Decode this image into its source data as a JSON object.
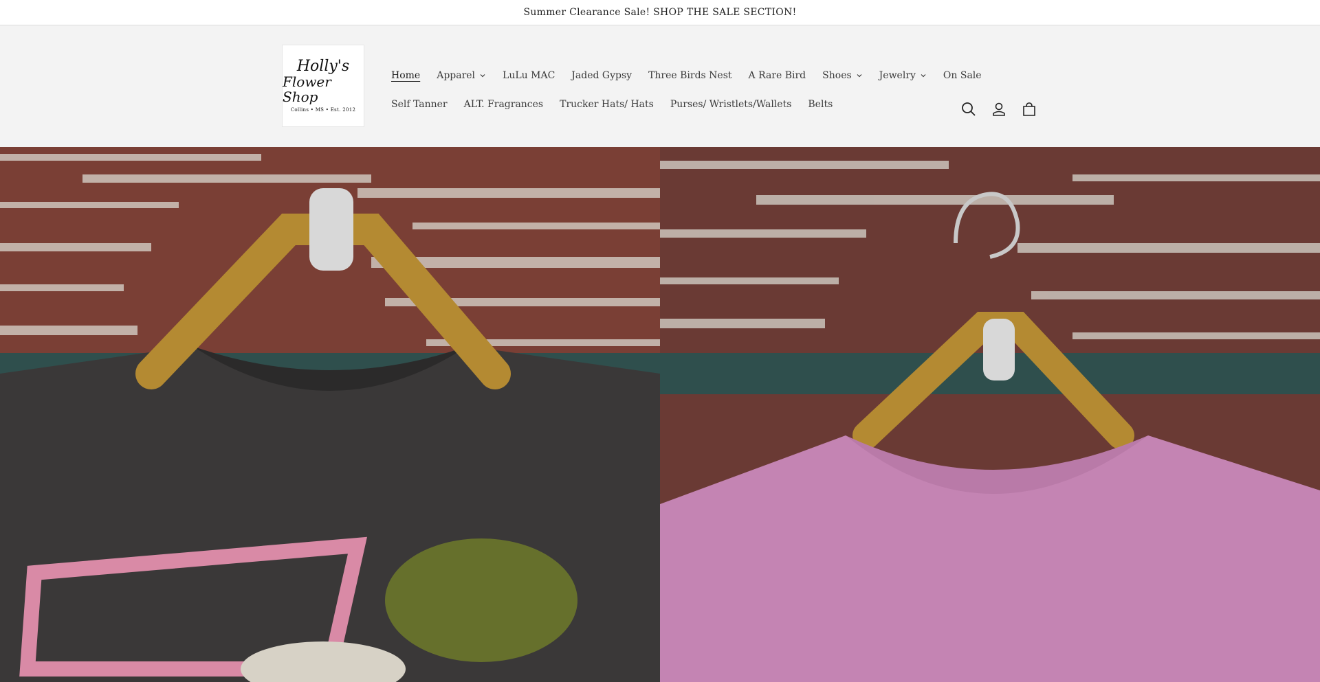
{
  "announcement": {
    "text": "Summer Clearance Sale! SHOP THE SALE SECTION!"
  },
  "logo": {
    "line1": "Holly's",
    "line2": "Flower Shop",
    "line3": "Collins • MS • Est. 2012"
  },
  "nav": {
    "row1": [
      {
        "label": "Home",
        "active": true,
        "dropdown": false
      },
      {
        "label": "Apparel",
        "dropdown": true
      },
      {
        "label": "LuLu MAC",
        "dropdown": false
      },
      {
        "label": "Jaded Gypsy",
        "dropdown": false
      },
      {
        "label": "Three Birds Nest",
        "dropdown": false
      },
      {
        "label": "A Rare Bird",
        "dropdown": false
      },
      {
        "label": "Shoes",
        "dropdown": true
      },
      {
        "label": "Jewelry",
        "dropdown": true
      },
      {
        "label": "On Sale",
        "dropdown": false
      }
    ],
    "row2": [
      {
        "label": "Self Tanner"
      },
      {
        "label": "ALT. Fragrances"
      },
      {
        "label": "Trucker Hats/ Hats"
      },
      {
        "label": "Purses/ Wristlets/Wallets"
      },
      {
        "label": "Belts"
      }
    ]
  },
  "icons": {
    "search": "search-icon",
    "account": "account-icon",
    "cart": "cart-icon"
  },
  "hero": {
    "left_image": "black graphic sweatshirt on sequin hanger",
    "right_image": "pink sweatshirt on sequin hanger"
  }
}
